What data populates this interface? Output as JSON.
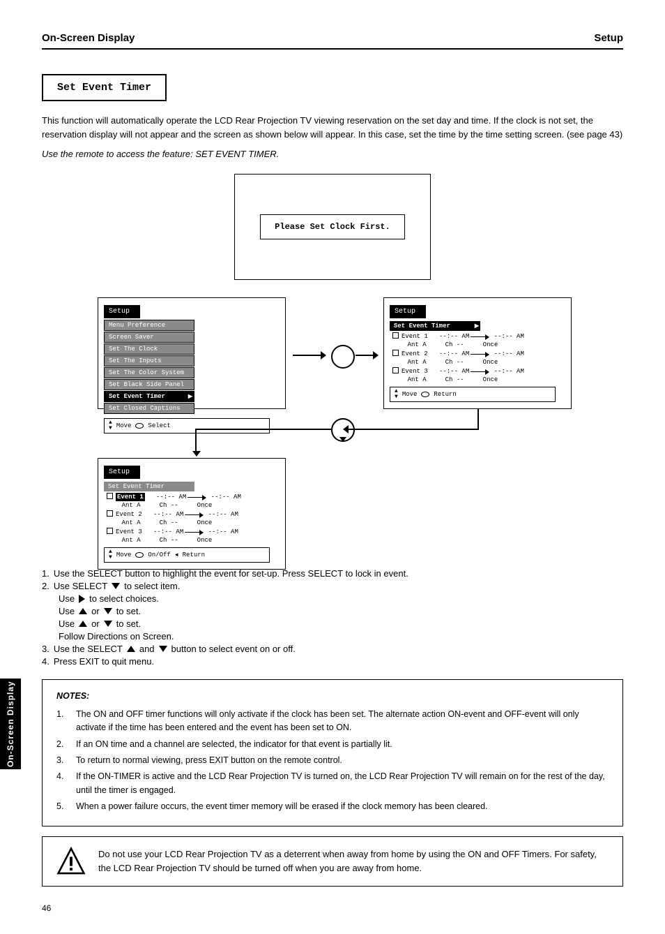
{
  "header": {
    "left": "On-Screen Display",
    "right": "Setup"
  },
  "tab_side": "On-Screen Display",
  "section_title": "Set Event Timer",
  "intro": {
    "p1": "This function will automatically operate the LCD Rear Projection TV viewing reservation on the set day and time. If the clock is not set, the reservation display will not appear and the screen as shown below will appear. In this case, set the time by the time setting screen. (see page 43)",
    "p2": "Use the remote to access the feature: SET EVENT TIMER."
  },
  "dialog_msg": "Please Set Clock First.",
  "osd": {
    "setup_menu": {
      "title": "Setup",
      "items": [
        "Menu Preference",
        "Screen Saver",
        "Set The Clock",
        "Set The Inputs",
        "Set The Color System",
        "Set Black Side Panel",
        "Set Event Timer",
        "Set Closed Captions"
      ],
      "selected_index": 6,
      "legend": {
        "move": "Move",
        "select": "Select"
      }
    },
    "event_panel_a": {
      "title": "Setup",
      "subtitle": "Set Event Timer",
      "events": [
        {
          "name": "Event 1",
          "start": "--:-- AM",
          "end": "--:-- AM",
          "src": "Ant A",
          "ch": "Ch --",
          "rep": "Once"
        },
        {
          "name": "Event 2",
          "start": "--:-- AM",
          "end": "--:-- AM",
          "src": "Ant A",
          "ch": "Ch --",
          "rep": "Once"
        },
        {
          "name": "Event 3",
          "start": "--:-- AM",
          "end": "--:-- AM",
          "src": "Ant A",
          "ch": "Ch --",
          "rep": "Once"
        }
      ],
      "legend": {
        "move": "Move",
        "return": "Return"
      }
    },
    "event_panel_b": {
      "title": "Setup",
      "subtitle": "Set Event Timer",
      "selected_event_index": 0,
      "events": [
        {
          "name": "Event 1",
          "start": "--:-- AM",
          "end": "--:-- AM",
          "src": "Ant A",
          "ch": "Ch --",
          "rep": "Once"
        },
        {
          "name": "Event 2",
          "start": "--:-- AM",
          "end": "--:-- AM",
          "src": "Ant A",
          "ch": "Ch --",
          "rep": "Once"
        },
        {
          "name": "Event 3",
          "start": "--:-- AM",
          "end": "--:-- AM",
          "src": "Ant A",
          "ch": "Ch --",
          "rep": "Once"
        }
      ],
      "legend": {
        "move": "Move",
        "onoff": "On/Off",
        "return": "Return"
      }
    }
  },
  "steps": {
    "s1": "Use the SELECT button to highlight the event for set-up. Press SELECT to lock in event.",
    "s2": {
      "a": "to select item.",
      "b_pre": "Use",
      "b_or": "or",
      "b_post": "to select choices.",
      "c_pre": "Use",
      "c_or": "or",
      "c_post": "to set.",
      "last": "Follow Directions on Screen."
    },
    "s3_pre": "Use the SELECT",
    "s3_or": "and",
    "s3_post": "button to select event on or off.",
    "s4": "Press EXIT to quit menu."
  },
  "notes": {
    "heading": "NOTES:",
    "items": [
      "The ON and OFF timer functions will only activate if the clock has been set. The alternate action ON-event and OFF-event will only activate if the time has been entered and the event has been set to ON.",
      "If an ON time and a channel are selected, the indicator for that event is partially lit.",
      "To return to normal viewing, press EXIT button on the remote control.",
      "If the ON-TIMER is active and the LCD Rear Projection TV is turned on, the LCD Rear Projection TV will remain on for the rest of the day, until the timer is engaged.",
      "When a power failure occurs, the event timer memory will be erased if the clock memory has been cleared."
    ]
  },
  "warning": "Do not use your LCD Rear Projection TV as a deterrent when away from home by using the ON and OFF Timers. For safety, the LCD Rear Projection TV should be turned off when you are away from home.",
  "page_number": "46"
}
